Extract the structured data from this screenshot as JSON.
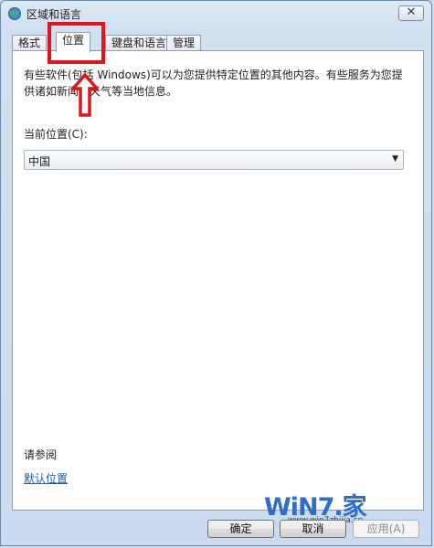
{
  "window": {
    "title": "区域和语言",
    "close_label": "✕"
  },
  "tabs": [
    {
      "label": "格式",
      "active": false
    },
    {
      "label": "位置",
      "active": true
    },
    {
      "label": "键盘和语言",
      "active": false
    },
    {
      "label": "管理",
      "active": false
    }
  ],
  "location": {
    "description": "有些软件(包括 Windows)可以为您提供特定位置的其他内容。有些服务为您提供诸如新闻和天气等当地信息。",
    "current_location_label": "当前位置(C):",
    "current_location_value": "中国"
  },
  "see_also": {
    "heading": "请参阅",
    "default_location_link": "默认位置"
  },
  "buttons": {
    "ok": "确定",
    "cancel": "取消",
    "apply": "应用(A)"
  },
  "watermark": {
    "logo": "WiN7.家",
    "url": "www.win7zhijia.cn"
  },
  "annotation": {
    "color": "#e2141b"
  }
}
